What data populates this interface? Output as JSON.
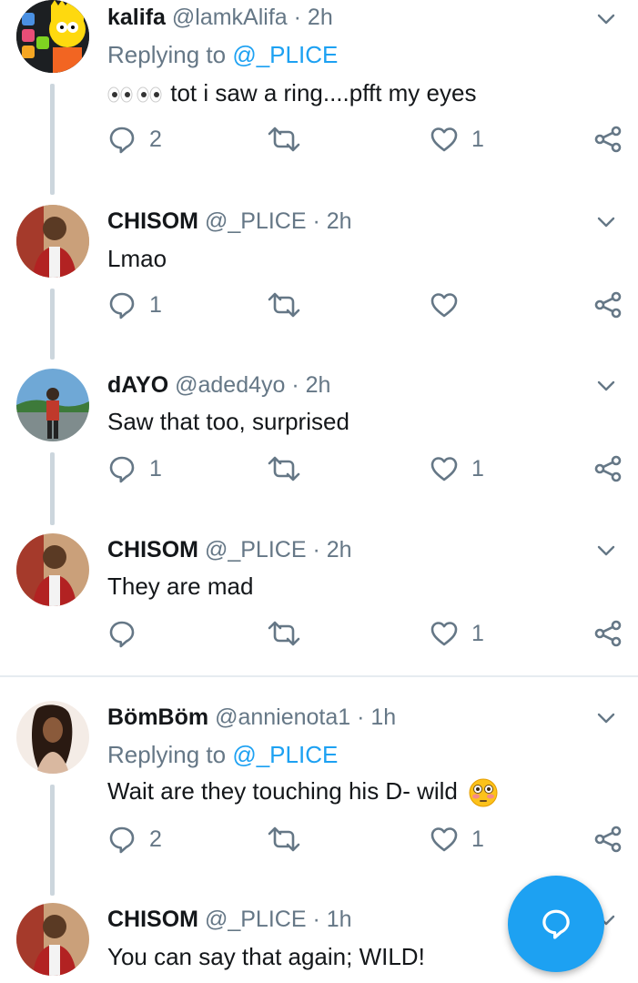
{
  "tweets": [
    {
      "name": "kalifa",
      "handle": "@lamkAlifa",
      "time": "2h",
      "replying_prefix": "Replying to ",
      "replying_to": "@_PLICE",
      "text": "tot i saw a ring....pfft my eyes",
      "emoji": "eyes-emoji x2",
      "replies": "2",
      "retweets": "",
      "likes": "1"
    },
    {
      "name": "CHISOM",
      "handle": "@_PLICE",
      "time": "2h",
      "text": "Lmao",
      "replies": "1",
      "retweets": "",
      "likes": ""
    },
    {
      "name": "dAYO",
      "handle": "@aded4yo",
      "time": "2h",
      "text": "Saw that too, surprised",
      "replies": "1",
      "retweets": "",
      "likes": "1"
    },
    {
      "name": "CHISOM",
      "handle": "@_PLICE",
      "time": "2h",
      "text": "They are mad",
      "replies": "",
      "retweets": "",
      "likes": "1"
    },
    {
      "name": "BömBöm",
      "handle": "@annienota1",
      "time": "1h",
      "replying_prefix": "Replying to ",
      "replying_to": "@_PLICE",
      "text": "Wait are they touching his D- wild",
      "emoji": "flushed-face-emoji",
      "replies": "2",
      "retweets": "",
      "likes": "1"
    },
    {
      "name": "CHISOM",
      "handle": "@_PLICE",
      "time": "1h",
      "text": "You can say that again; WILD!"
    }
  ],
  "separator": "·",
  "colors": {
    "accent": "#1da1f2",
    "muted": "#657786",
    "thread_line": "#ccd6dd",
    "divider": "#e6ecf0"
  },
  "icons": {
    "reply": "reply-icon",
    "retweet": "retweet-icon",
    "like": "heart-icon",
    "share": "share-icon",
    "menu": "chevron-down-icon",
    "fab": "compose-reply-icon"
  }
}
